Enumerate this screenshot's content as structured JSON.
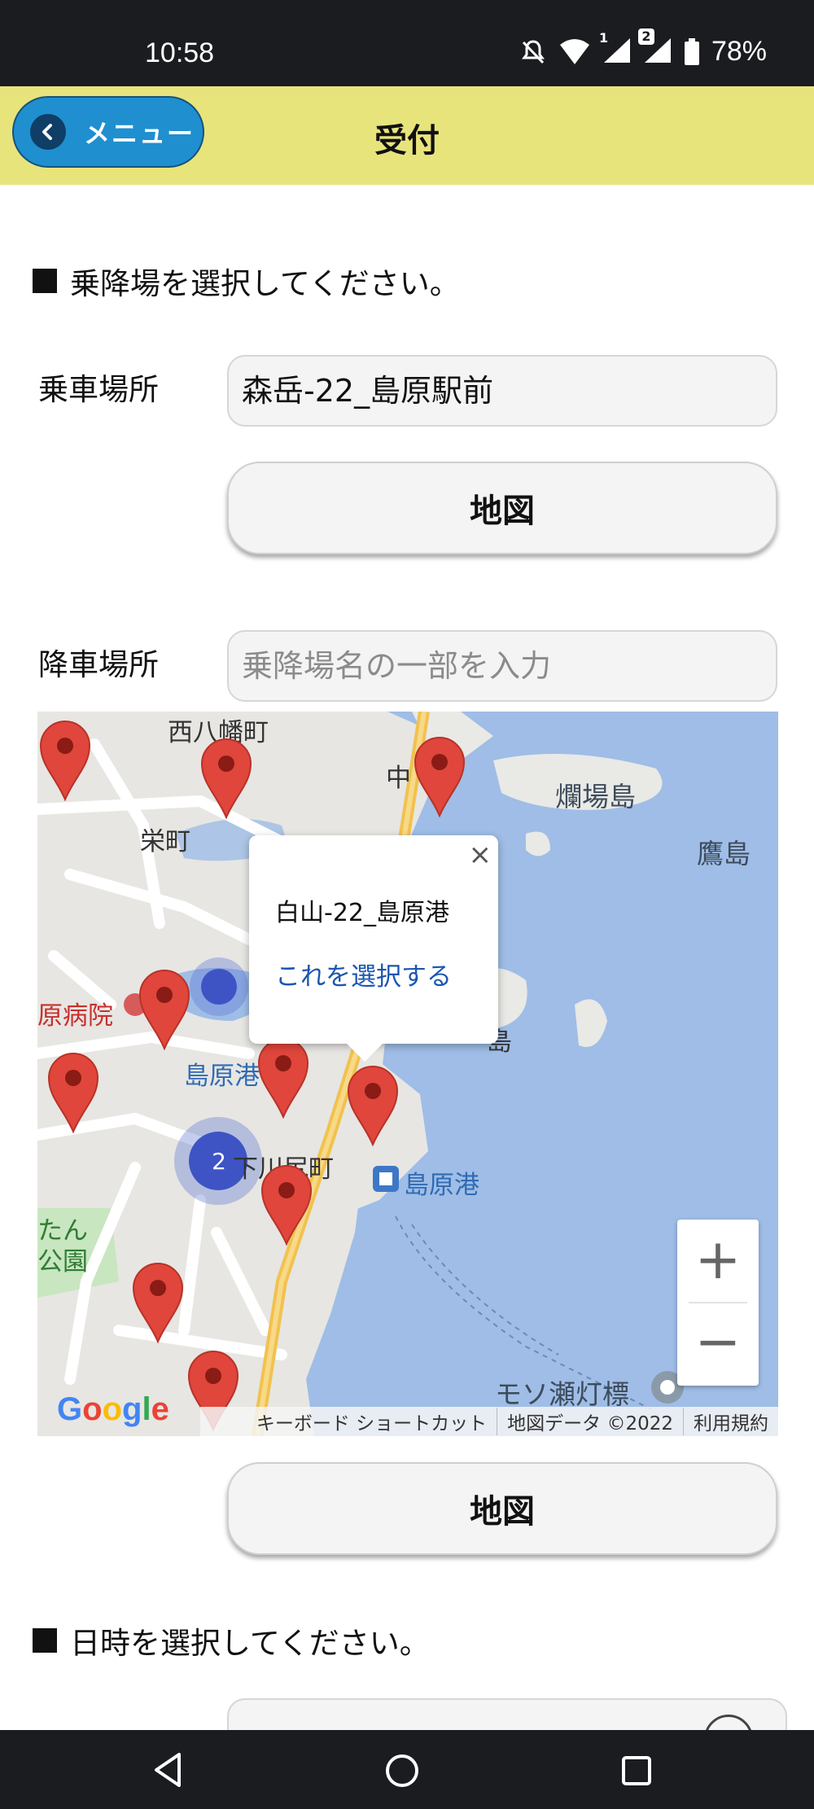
{
  "status_bar": {
    "time": "10:58",
    "battery": "78%",
    "sim1": "1",
    "sim2": "2"
  },
  "header": {
    "menu_label": "メニュー",
    "title": "受付"
  },
  "pickup_section": {
    "heading": "乗降場を選択してください。"
  },
  "pickup": {
    "label": "乗車場所",
    "value": "森岳-22_島原駅前",
    "map_button": "地図"
  },
  "dropoff": {
    "label": "降車場所",
    "placeholder": "乗降場名の一部を入力",
    "map_button": "地図"
  },
  "map": {
    "labels": {
      "nishi_hachiman": "西八幡町",
      "sakaemachi": "栄町",
      "naka": "中",
      "rannbajima": "爛場島",
      "takashima": "鷹島",
      "hospital": "原病院",
      "shimabarako_small": "島原港",
      "shimokawajiri": "下川尻町",
      "ferry_terminal": "島原港",
      "park1": "たん",
      "park2": "公園",
      "island": "島",
      "lighthouse": "モソ瀬灯標"
    },
    "cluster_count": "2",
    "popup": {
      "stop_name": "白山-22_島原港",
      "select_link": "これを選択する",
      "close": "×"
    },
    "zoom_in": "+",
    "zoom_out": "−",
    "logo": "Google",
    "footer": {
      "shortcuts": "キーボード ショートカット",
      "map_data": "地図データ ©2022",
      "terms": "利用規約"
    }
  },
  "datetime_section": {
    "heading": "日時を選択してください。"
  },
  "colors": {
    "header_bg": "#e8e47c",
    "menu_button": "#1f8fd0",
    "pin": "#e0463b",
    "water": "#9fbde6",
    "link": "#1a56b0"
  }
}
